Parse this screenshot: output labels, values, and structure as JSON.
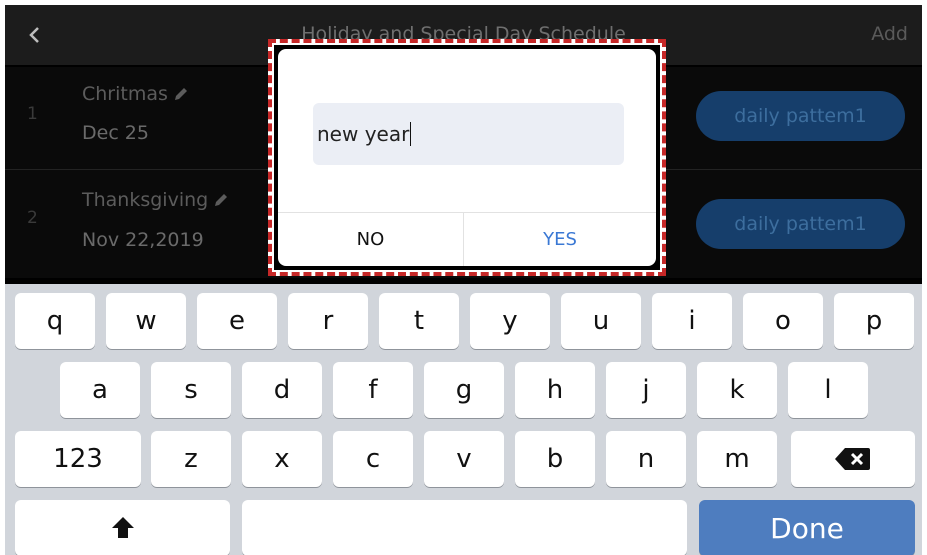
{
  "header": {
    "title": "Holiday and Special Day Schedule",
    "back_icon": "chevron-left-icon",
    "add_label": "Add"
  },
  "holidays": [
    {
      "index": "1",
      "name": "Chritmas",
      "date": "Dec 25",
      "pattern": "daily pattem1"
    },
    {
      "index": "2",
      "name": "Thanksgiving",
      "date": "Nov 22,2019",
      "pattern": "daily pattem1"
    }
  ],
  "dialog": {
    "input_value": "new year",
    "no_label": "NO",
    "yes_label": "YES"
  },
  "keyboard": {
    "row1": [
      "q",
      "w",
      "e",
      "r",
      "t",
      "y",
      "u",
      "i",
      "o",
      "p"
    ],
    "row2": [
      "a",
      "s",
      "d",
      "f",
      "g",
      "h",
      "j",
      "k",
      "l"
    ],
    "row3": [
      "z",
      "x",
      "c",
      "v",
      "b",
      "n",
      "m"
    ],
    "numbers_label": "123",
    "done_label": "Done",
    "backspace_icon": "backspace-icon",
    "shift_icon": "shift-icon"
  },
  "colors": {
    "accent": "#4e7dbf",
    "highlight_outline": "#c62828",
    "yes_text": "#3a78d4"
  }
}
